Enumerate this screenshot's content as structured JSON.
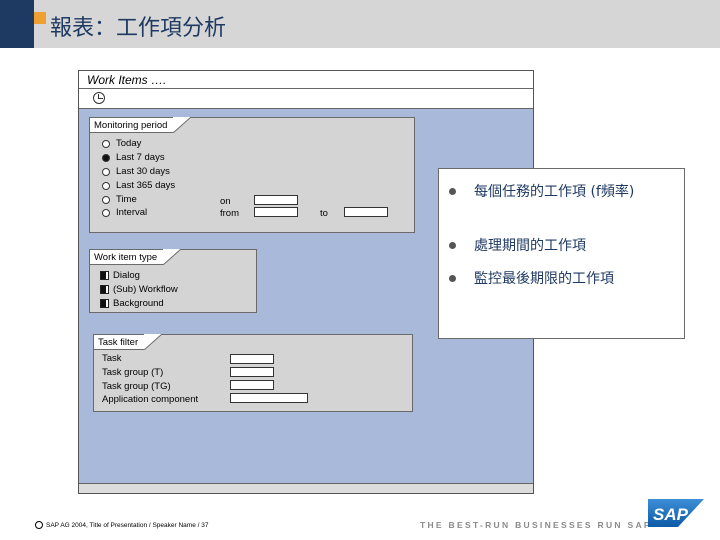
{
  "slide": {
    "title": "報表：工作項分析",
    "footer_text": "SAP AG 2004, Title of Presentation / Speaker Name / 37",
    "slogan": "THE BEST-RUN BUSINESSES RUN SAP",
    "logo_text": "SAP"
  },
  "window": {
    "title": "Work Items ….",
    "toolbar_icon": "clock-icon"
  },
  "monitoring": {
    "tab_label": "Monitoring period",
    "options": [
      {
        "label": "Today",
        "selected": false
      },
      {
        "label": "Last 7  days",
        "selected": true
      },
      {
        "label": "Last 30 days",
        "selected": false
      },
      {
        "label": "Last 365 days",
        "selected": false
      },
      {
        "label": "Time",
        "selected": false
      },
      {
        "label": "Interval",
        "selected": false
      }
    ],
    "on_label": "on",
    "from_label": "from",
    "to_label": "to"
  },
  "work_item_type": {
    "tab_label": "Work item type",
    "options": [
      {
        "label": "Dialog",
        "checked": true
      },
      {
        "label": "(Sub) Workflow",
        "checked": true
      },
      {
        "label": "Background",
        "checked": true
      }
    ]
  },
  "task_filter": {
    "tab_label": "Task filter",
    "fields": [
      {
        "label": "Task"
      },
      {
        "label": "Task group (T)"
      },
      {
        "label": "Task group (TG)"
      },
      {
        "label": "Application component"
      }
    ]
  },
  "bullets": [
    "每個任務的工作項 (f頻率)",
    "處理期間的工作項",
    "監控最後期限的工作項"
  ],
  "colors": {
    "navy": "#1f3a62",
    "accent_orange": "#f0a030",
    "window_bg": "#a9b9d9",
    "logo_blue": "#0d5aa7"
  }
}
